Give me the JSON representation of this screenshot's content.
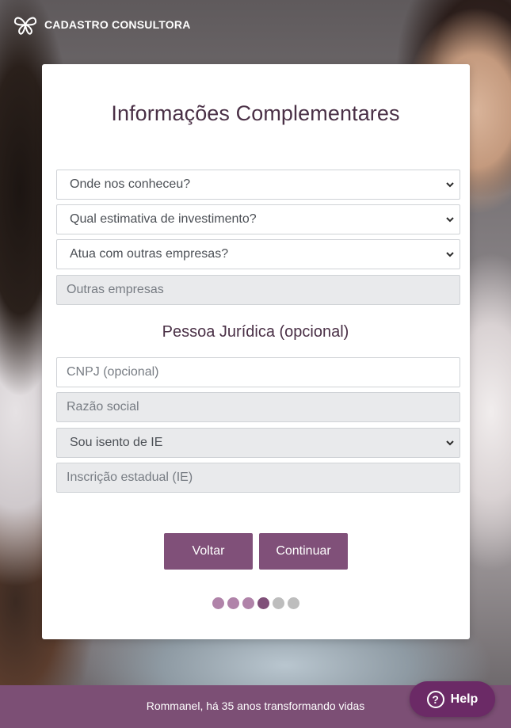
{
  "header": {
    "brand": "CADASTRO CONSULTORA",
    "logo_icon": "butterfly-icon"
  },
  "card": {
    "title": "Informações Complementares",
    "fields": {
      "how_found": "Onde nos conheceu?",
      "investment": "Qual estimativa de investimento?",
      "other_companies_select": "Atua com outras empresas?",
      "other_companies_input_placeholder": "Outras empresas"
    },
    "section_title": "Pessoa Jurídica (opcional)",
    "pj_fields": {
      "cnpj_placeholder": "CNPJ (opcional)",
      "razao_social_placeholder": "Razão social",
      "ie_select": "Sou isento de IE",
      "ie_input_placeholder": "Inscrição estadual (IE)"
    },
    "buttons": {
      "back": "Voltar",
      "continue": "Continuar"
    },
    "progress": {
      "total_steps": 6,
      "current_step": 4,
      "done_color": "#b083a9",
      "current_color": "#805079",
      "pending_color": "#bdbdbd"
    }
  },
  "footer": {
    "text": "Rommanel, há 35 anos transformando vidas"
  },
  "help": {
    "label": "Help",
    "icon": "question-mark-icon"
  },
  "colors": {
    "accent": "#805079",
    "footer": "#7c4f75",
    "help_button": "#6b2a66",
    "title": "#4a3046"
  }
}
